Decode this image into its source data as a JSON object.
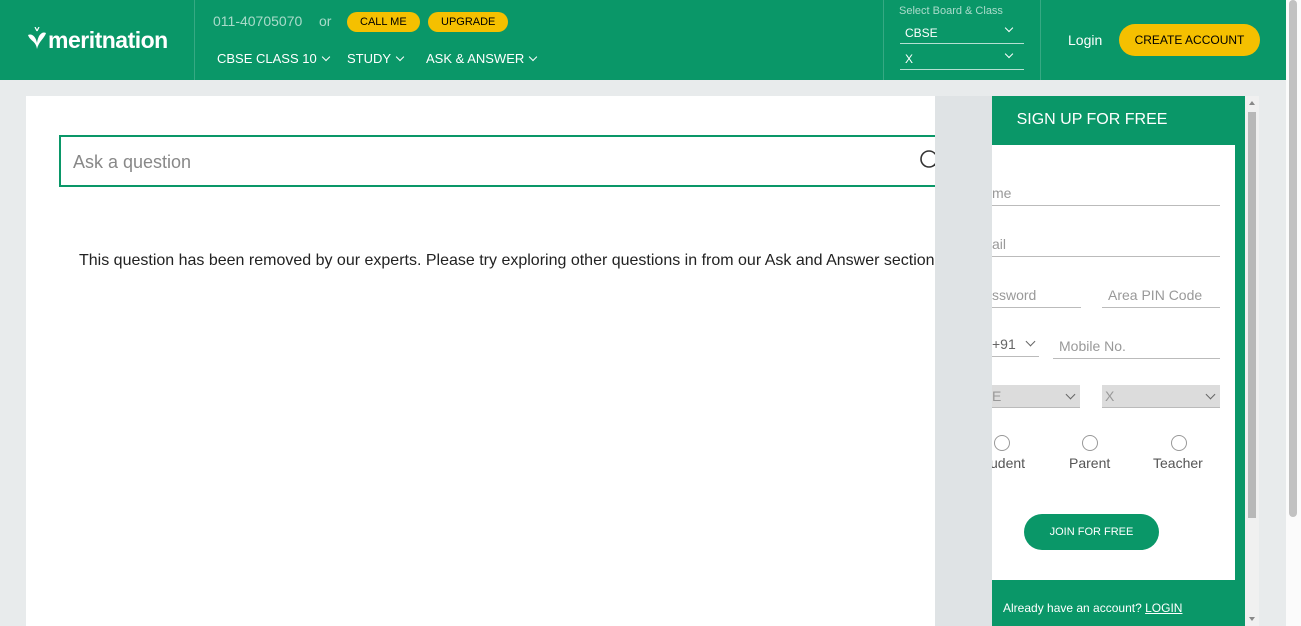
{
  "header": {
    "logo_text": "meritnation",
    "phone": "011-40705070",
    "or_text": "or",
    "call_me_label": "CALL ME",
    "upgrade_label": "UPGRADE",
    "nav": [
      {
        "label": "CBSE CLASS 10"
      },
      {
        "label": "STUDY"
      },
      {
        "label": "ASK & ANSWER"
      }
    ],
    "board_select": {
      "label": "Select Board & Class",
      "board_value": "CBSE",
      "class_value": "X"
    },
    "login_label": "Login",
    "create_account_label": "CREATE ACCOUNT"
  },
  "main": {
    "search_placeholder": "Ask a question",
    "removed_message": "This question has been removed by our experts. Please try exploring other questions in from our Ask and Answer section."
  },
  "signup": {
    "title": "SIGN UP FOR FREE",
    "name_placeholder": "me",
    "email_placeholder": "ail",
    "password_placeholder": "ssword",
    "pin_placeholder": "Area PIN Code",
    "country_code": "+91",
    "mobile_placeholder": "Mobile No.",
    "board_value": "E",
    "class_value": "X",
    "roles": [
      "udent",
      "Parent",
      "Teacher"
    ],
    "join_label": "JOIN FOR FREE",
    "already_text": "Already have an account?",
    "login_link": "LOGIN"
  },
  "colors": {
    "brand_green": "#0a9768",
    "accent_yellow": "#f5c000"
  }
}
